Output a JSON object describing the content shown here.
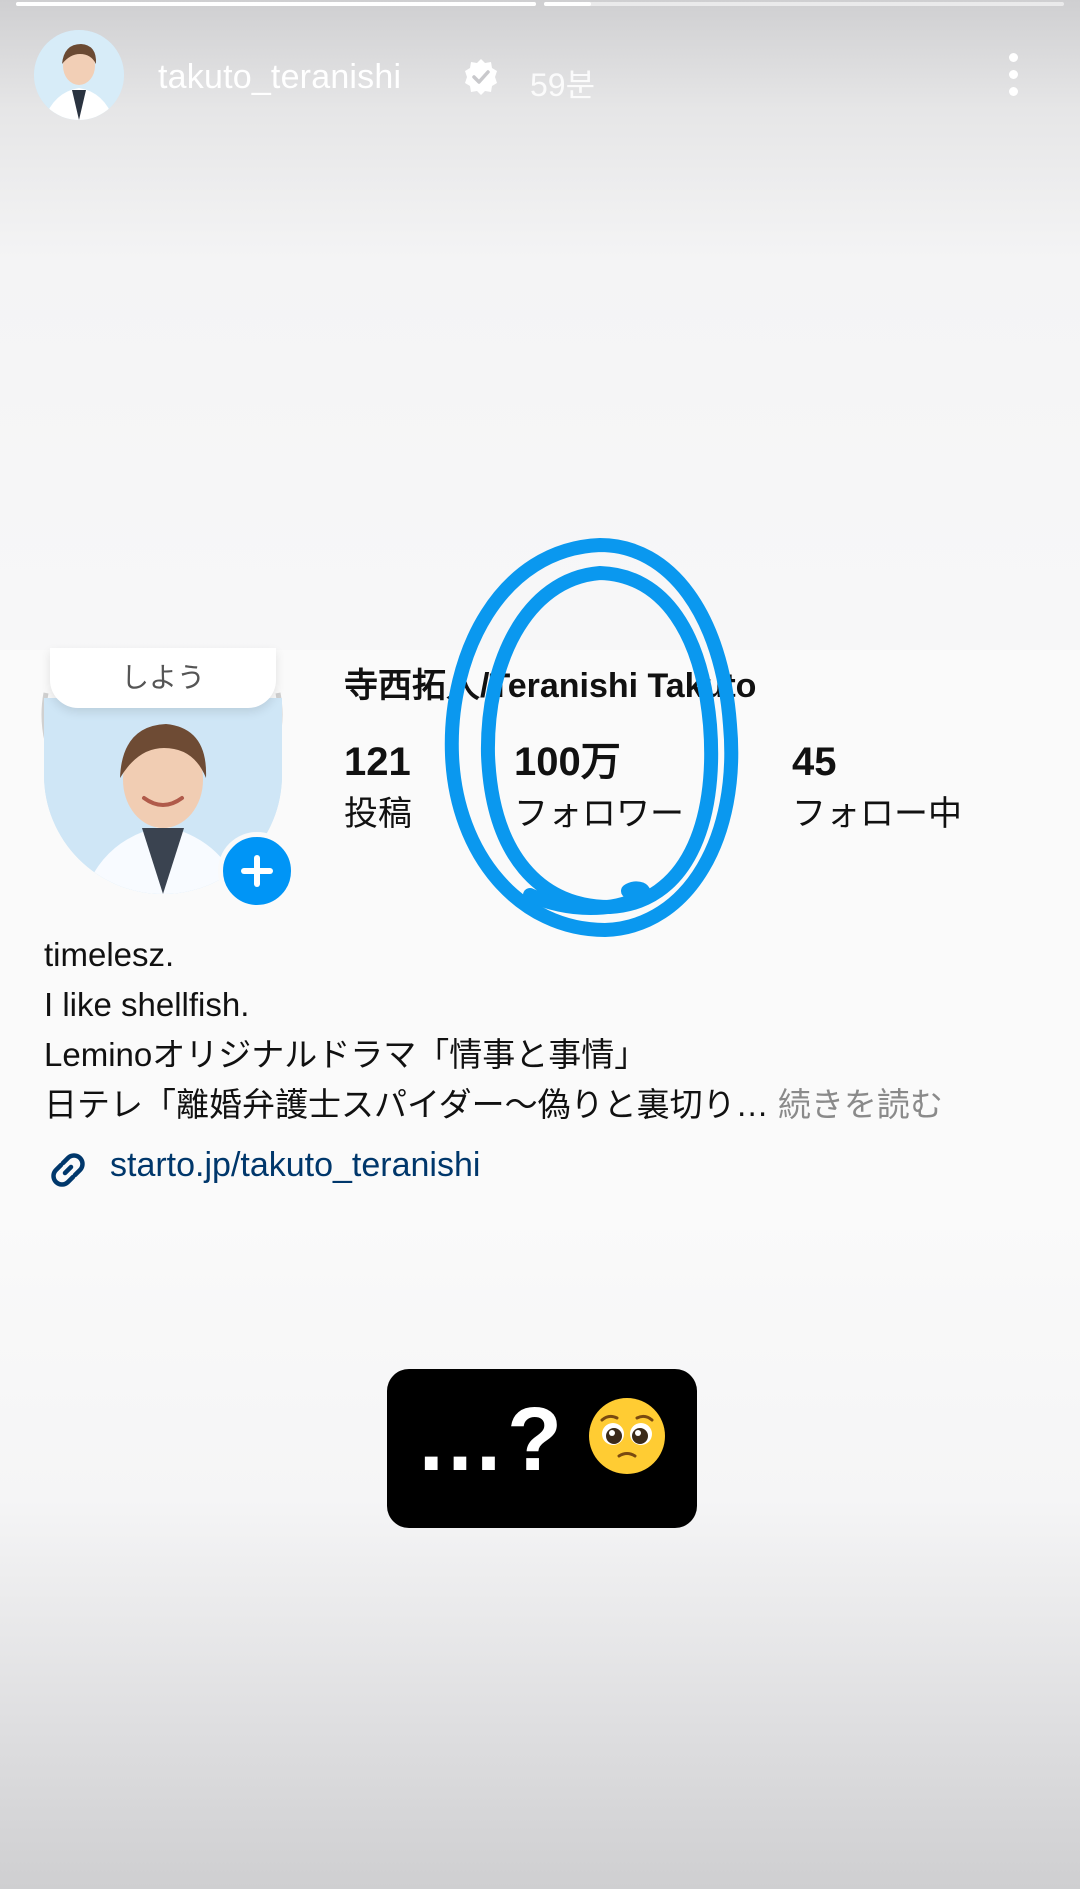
{
  "story": {
    "progress": [
      1.0,
      0.09
    ],
    "username": "takuto_teranishi",
    "verified": true,
    "time_ago": "59분"
  },
  "profile": {
    "tooltip": "しよう",
    "display_name": "寺西拓人/Teranishi Takuto",
    "stats": {
      "posts_value": "121",
      "posts_label": "投稿",
      "followers_value": "100万",
      "followers_label": "フォロワー",
      "following_value": "45",
      "following_label": "フォロー中"
    },
    "bio_lines": [
      "timelesz.",
      "I like shellfish.",
      "Leminoオリジナルドラマ「情事と事情」",
      "日テレ「離婚弁護士スパイダー〜偽りと裏切り…"
    ],
    "read_more": "続きを読む",
    "link": "starto.jp/takuto_teranishi"
  },
  "sticker": {
    "text": "…?"
  },
  "colors": {
    "accent_blue": "#0095f6",
    "annotation_blue": "#0a98ef",
    "link_blue": "#00376b",
    "sticker_bg": "#000000"
  },
  "icons": [
    "verified-badge-icon",
    "more-options-icon",
    "add-story-icon",
    "link-icon",
    "pleading-face-emoji"
  ]
}
